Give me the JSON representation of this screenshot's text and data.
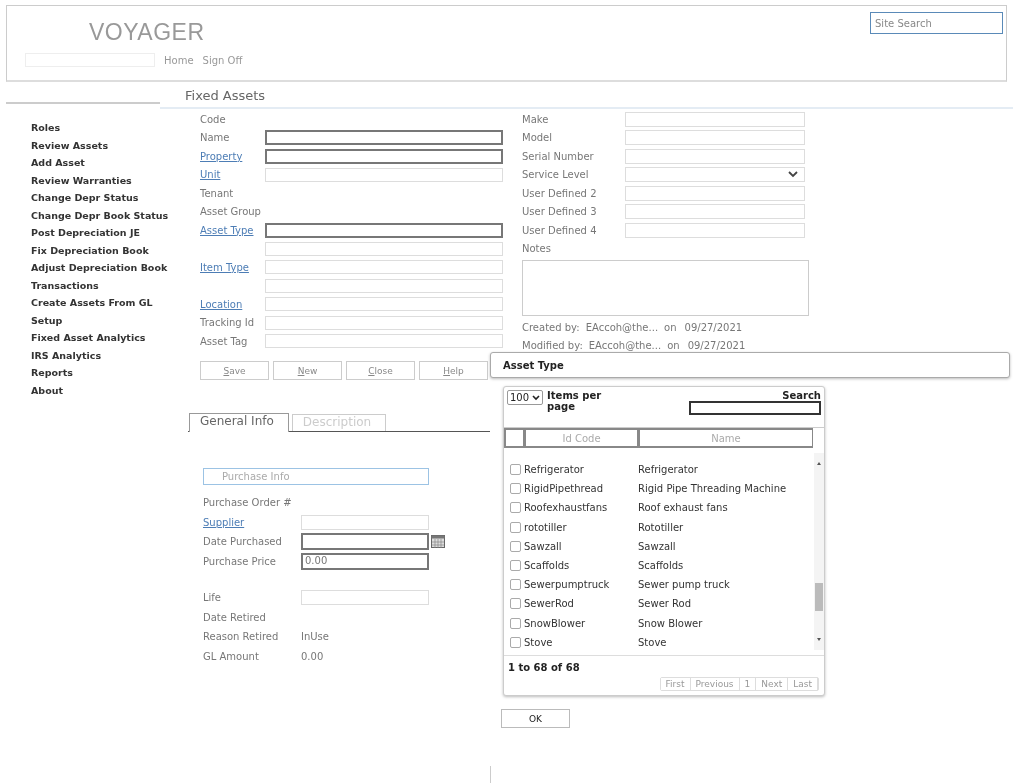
{
  "header": {
    "logo": "VOYAGER",
    "site_search": {
      "placeholder": "Site Search"
    },
    "nav": [
      "Home",
      "Sign Off"
    ]
  },
  "page_title": "Fixed Assets",
  "sidebar": {
    "items": [
      "Roles",
      "Review Assets",
      "Add Asset",
      "Review Warranties",
      "Change Depr Status",
      "Change Depr Book Status",
      "Post Depreciation JE",
      "Fix Depreciation Book",
      "Adjust Depreciation Book",
      "Transactions",
      "Create Assets From GL",
      "Setup",
      "Fixed Asset Analytics",
      "IRS Analytics",
      "Reports",
      "About"
    ]
  },
  "left_fields": [
    {
      "label": "Code",
      "link": false,
      "kind": "label"
    },
    {
      "label": "Name",
      "link": false,
      "kind": "required_input"
    },
    {
      "label": "Property",
      "link": true,
      "kind": "required_input"
    },
    {
      "label": "Unit",
      "link": true,
      "kind": "input"
    },
    {
      "label": "Tenant",
      "link": false,
      "kind": "label"
    },
    {
      "label": "Asset Group",
      "link": false,
      "kind": "label"
    },
    {
      "label": "Asset Type",
      "link": true,
      "kind": "required_input"
    },
    {
      "kind": "input"
    },
    {
      "label": "Item Type",
      "link": true,
      "kind": "input"
    },
    {
      "kind": "input"
    },
    {
      "label": "Location",
      "link": true,
      "kind": "input"
    },
    {
      "label": "Tracking Id",
      "link": false,
      "kind": "input"
    },
    {
      "label": "Asset Tag",
      "link": false,
      "kind": "input"
    }
  ],
  "right_fields": [
    {
      "label": "Make",
      "kind": "input"
    },
    {
      "label": "Model",
      "kind": "input"
    },
    {
      "label": "Serial Number",
      "kind": "input"
    },
    {
      "label": "Service Level",
      "kind": "select"
    },
    {
      "label": "User Defined 2",
      "kind": "input"
    },
    {
      "label": "User Defined 3",
      "kind": "input"
    },
    {
      "label": "User Defined 4",
      "kind": "input"
    },
    {
      "label": "Notes",
      "kind": "label"
    }
  ],
  "audit": [
    {
      "label": "Created by:",
      "user": "EAccoh@the...",
      "on": "on",
      "date": "09/27/2021"
    },
    {
      "label": "Modified by:",
      "user": "EAccoh@the...",
      "on": "on",
      "date": "09/27/2021"
    }
  ],
  "buttons": [
    "Save",
    "New",
    "Close",
    "Help"
  ],
  "tabs": [
    {
      "label": "General Info",
      "selected": true
    },
    {
      "label": "Description",
      "selected": false
    }
  ],
  "purchase": {
    "legend": "Purchase Info",
    "fields": [
      {
        "label": "Purchase Order #",
        "link": false,
        "kind": "label"
      },
      {
        "label": "Supplier",
        "link": true,
        "kind": "input"
      },
      {
        "label": "Date Purchased",
        "link": false,
        "kind": "date"
      },
      {
        "label": "Purchase Price",
        "link": false,
        "kind": "required_input",
        "value": "0.00"
      },
      {
        "label": "Life",
        "link": false,
        "kind": "input",
        "gap_before": true
      },
      {
        "label": "Date Retired",
        "link": false,
        "kind": "label"
      },
      {
        "label": "Reason Retired",
        "link": false,
        "kind": "value",
        "value": "InUse"
      },
      {
        "label": "GL Amount",
        "link": false,
        "kind": "value",
        "value": "0.00"
      }
    ]
  },
  "dialog": {
    "title": "Asset Type",
    "per_page": "100",
    "per_page_label": "Items per page",
    "search_label": "Search",
    "columns": [
      "Id Code",
      "Name"
    ],
    "rows": [
      {
        "id": "Refrigerator",
        "name": "Refrigerator",
        "checked": false
      },
      {
        "id": "RigidPipethread",
        "name": "Rigid Pipe Threading Machine",
        "checked": false
      },
      {
        "id": "Roofexhaustfans",
        "name": "Roof exhaust fans",
        "checked": false
      },
      {
        "id": "rototiller",
        "name": "Rototiller",
        "checked": false
      },
      {
        "id": "Sawzall",
        "name": "Sawzall",
        "checked": false
      },
      {
        "id": "Scaffolds",
        "name": "Scaffolds",
        "checked": false
      },
      {
        "id": "Sewerpumptruck",
        "name": "Sewer pump truck",
        "checked": false
      },
      {
        "id": "SewerRod",
        "name": "Sewer Rod",
        "checked": false
      },
      {
        "id": "SnowBlower",
        "name": "Snow Blower",
        "checked": false
      },
      {
        "id": "Stove",
        "name": "Stove",
        "checked": false
      }
    ],
    "summary": "1 to 68 of 68",
    "pager": [
      {
        "label": "First",
        "disabled": true
      },
      {
        "label": "Previous",
        "disabled": true
      },
      {
        "label": "1",
        "disabled": true
      },
      {
        "label": "Next",
        "disabled": true
      },
      {
        "label": "Last",
        "disabled": true
      }
    ],
    "ok": "OK"
  }
}
